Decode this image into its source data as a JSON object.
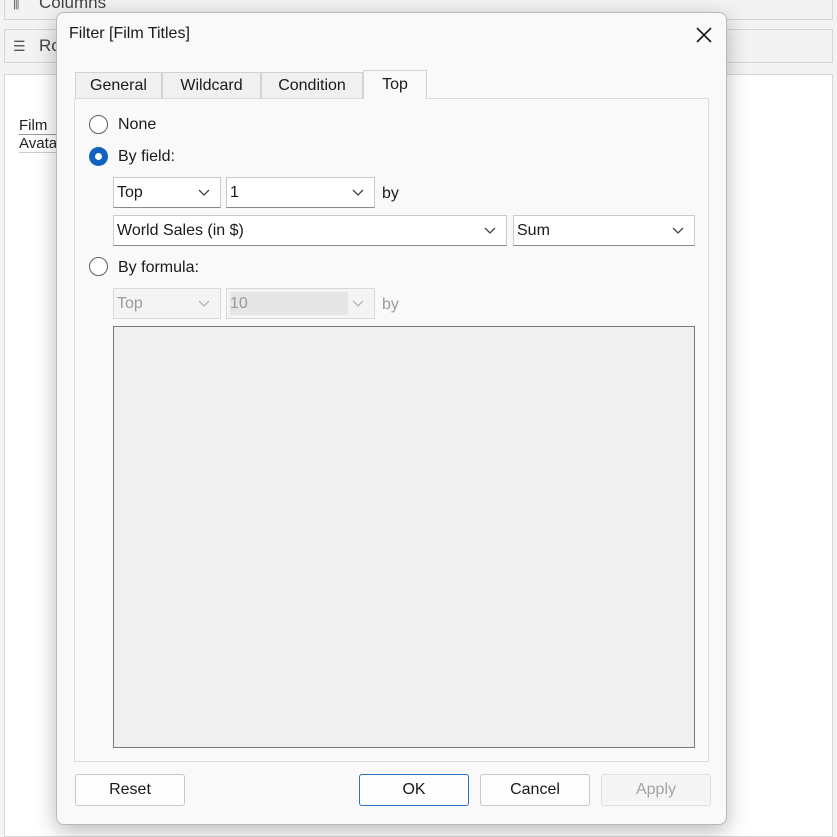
{
  "background": {
    "columns_label": "Columns",
    "rows_label": "Ro",
    "table": {
      "header": "Film",
      "row": "Avata"
    }
  },
  "dialog": {
    "title": "Filter [Film Titles]",
    "tabs": [
      "General",
      "Wildcard",
      "Condition",
      "Top"
    ],
    "active_tab": "Top",
    "options": {
      "none_label": "None",
      "by_field_label": "By field:",
      "by_formula_label": "By formula:"
    },
    "by_field": {
      "direction": "Top",
      "count": "1",
      "by_label": "by",
      "field": "World Sales (in $)",
      "aggregation": "Sum"
    },
    "by_formula": {
      "direction": "Top",
      "count": "10",
      "by_label": "by"
    },
    "buttons": {
      "reset": "Reset",
      "ok": "OK",
      "cancel": "Cancel",
      "apply": "Apply"
    },
    "colors": {
      "accent": "#0f62c0",
      "primary_border": "#2a73c4"
    }
  }
}
